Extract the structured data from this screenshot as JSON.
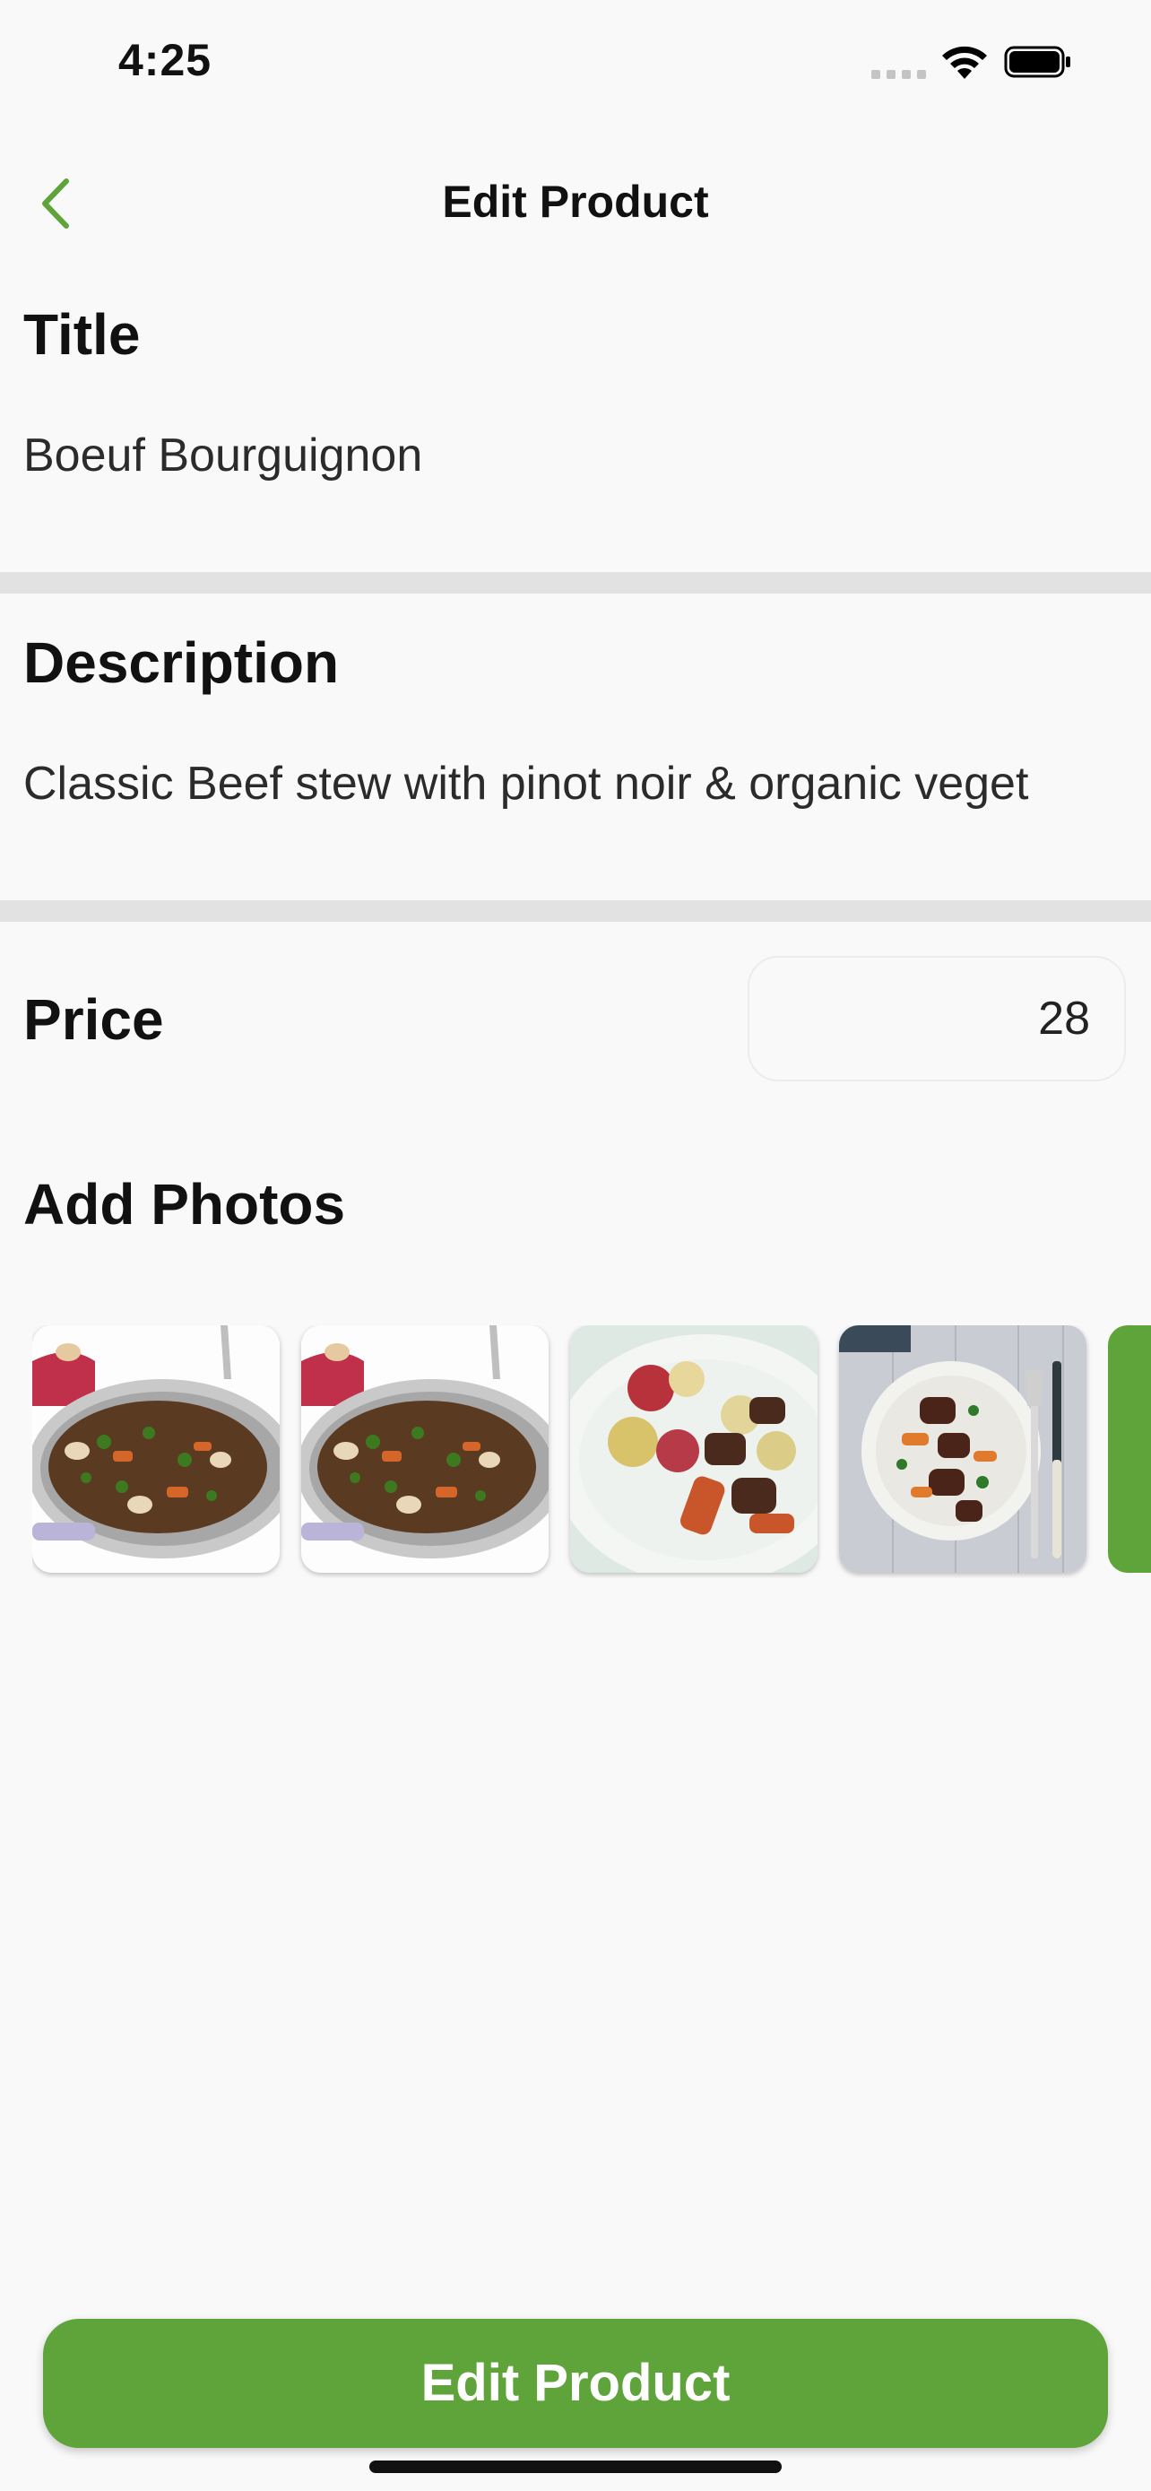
{
  "status_bar": {
    "time": "4:25"
  },
  "nav": {
    "title": "Edit Product",
    "back_icon": "chevron-left-icon",
    "accent_color": "#5ea43a"
  },
  "form": {
    "title_label": "Title",
    "title_value": "Boeuf Bourguignon",
    "description_label": "Description",
    "description_value": "Classic Beef stew with pinot noir & organic veget",
    "price_label": "Price",
    "price_value": "28",
    "photos_label": "Add Photos"
  },
  "photos": [
    {
      "name": "stew-pan-photo-1"
    },
    {
      "name": "stew-pan-photo-2"
    },
    {
      "name": "stew-bowl-potatoes-photo"
    },
    {
      "name": "stew-plate-cutlery-photo"
    }
  ],
  "actions": {
    "submit_label": "Edit Product",
    "button_color": "#5ea43a"
  }
}
